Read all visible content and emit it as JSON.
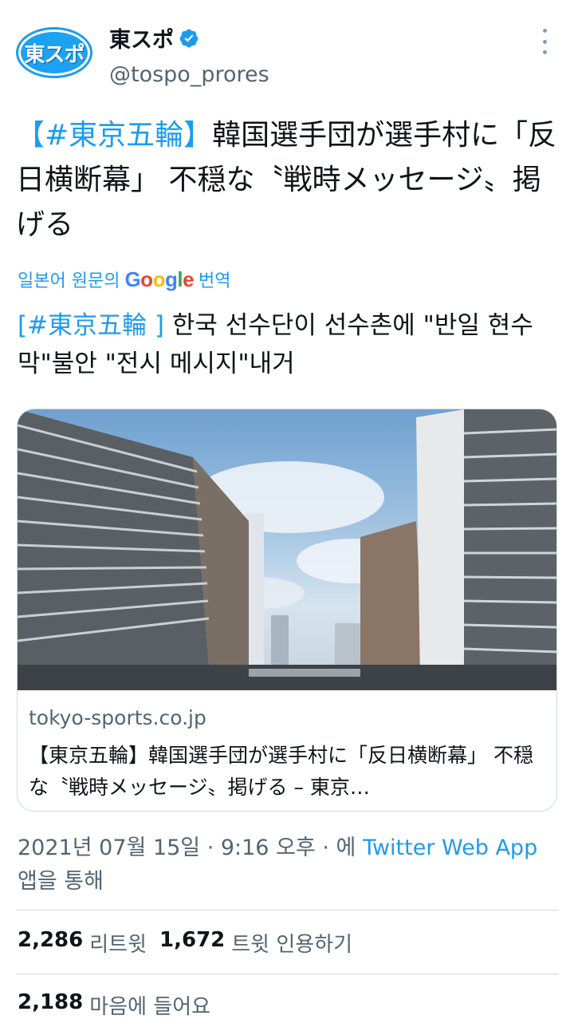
{
  "author": {
    "avatar_text": "東スポ",
    "display_name": "東スポ",
    "handle": "@tospo_prores"
  },
  "tweet": {
    "hashtag": "【#東京五輪】",
    "text": "韓国選手団が選手村に「反日横断幕」 不穏な〝戦時メッセージ〟掲げる"
  },
  "translation": {
    "prefix": "일본어 원문의",
    "google": "Google",
    "suffix": "번역",
    "hashtag": "[#東京五輪 ]",
    "text": "한국 선수단이 선수촌에 \"반일 현수막\"불안 \"전시 메시지\"내거"
  },
  "card": {
    "domain": "tokyo-sports.co.jp",
    "title": "【東京五輪】韓国選手団が選手村に「反日横断幕」 不穏な〝戦時メッセージ〟掲げる – 東京…"
  },
  "meta": {
    "timestamp": "2021년 07월 15일 · 9:16 오후 · 에 ",
    "source": "Twitter Web App",
    "via": "앱을 통해"
  },
  "stats": {
    "retweets_count": "2,286",
    "retweets_label": "리트윗",
    "quotes_count": "1,672",
    "quotes_label": "트윗 인용하기",
    "likes_count": "2,188",
    "likes_label": "마음에 들어요"
  },
  "colors": {
    "accent": "#1d9bf0",
    "secondary_text": "#536471",
    "divider": "#cfd9de"
  }
}
